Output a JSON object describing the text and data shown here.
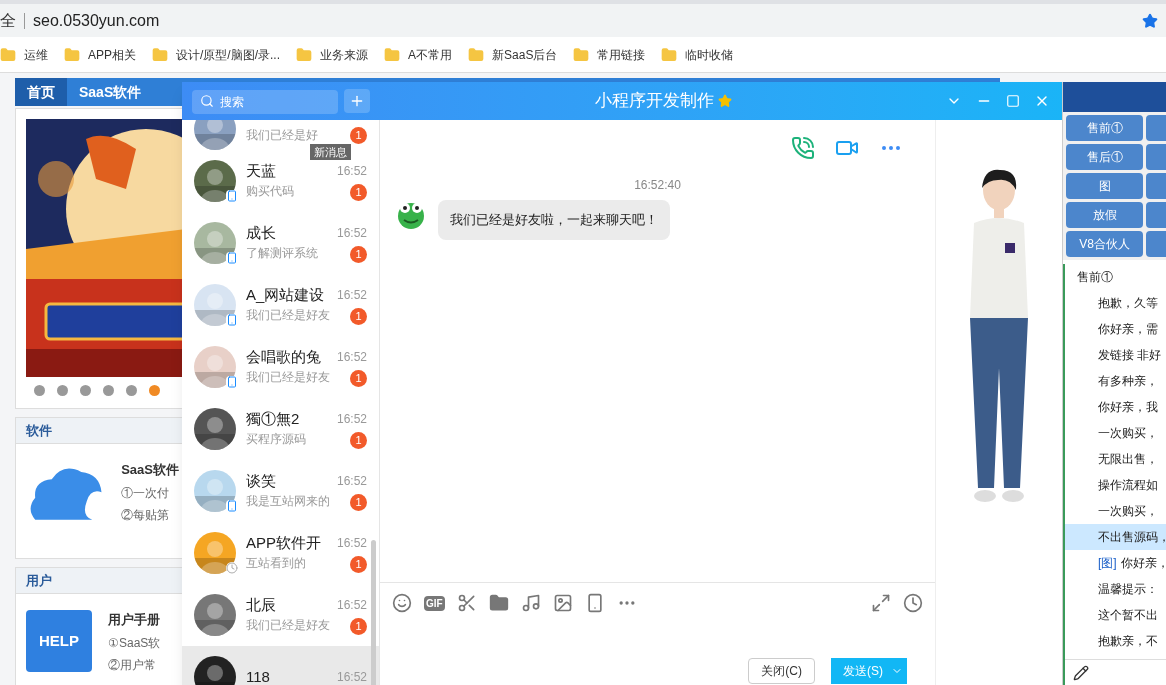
{
  "browser": {
    "address_prefix": "全",
    "url": "seo.0530yun.com",
    "bookmarks": [
      "运维",
      "APP相关",
      "设计/原型/脑图/录...",
      "业务来源",
      "A不常用",
      "新SaaS后台",
      "常用链接",
      "临时收储"
    ]
  },
  "site": {
    "nav": [
      {
        "label": "首页",
        "selected": true
      },
      {
        "label": "SaaS软件",
        "selected": false
      }
    ],
    "banner": {
      "dots": [
        {
          "selected": false
        },
        {
          "selected": false
        },
        {
          "selected": false
        },
        {
          "selected": false
        },
        {
          "selected": false
        },
        {
          "selected": true
        }
      ]
    },
    "sections": [
      {
        "kind": "cloud",
        "title": "软件",
        "item_title": "SaaS软件",
        "lines": [
          "①一次付",
          "②每贴第"
        ]
      },
      {
        "kind": "book",
        "title": "用户",
        "item_title": "用户手册",
        "lines": [
          "①SaaS软",
          "②用户常"
        ],
        "icon_text": "HELP"
      }
    ]
  },
  "chat": {
    "title": "小程序开发制作",
    "search": {
      "placeholder": "搜索"
    },
    "tooltip": "新消息",
    "contacts": [
      {
        "preview": "我们已经是好",
        "badge": "1",
        "selected": false,
        "partial": true,
        "mobile": false,
        "away": false
      },
      {
        "name": "天蓝",
        "preview": "购买代码",
        "time": "16:52",
        "badge": "1",
        "selected": false,
        "partial": false,
        "mobile": true,
        "away": false
      },
      {
        "name": "成长",
        "preview": "了解测评系统",
        "time": "16:52",
        "badge": "1",
        "selected": false,
        "partial": false,
        "mobile": true,
        "away": false
      },
      {
        "name": "A_网站建设",
        "preview": "我们已经是好友",
        "time": "16:52",
        "badge": "1",
        "selected": false,
        "partial": false,
        "mobile": true,
        "away": false
      },
      {
        "name": "会唱歌的兔",
        "preview": "我们已经是好友",
        "time": "16:52",
        "badge": "1",
        "selected": false,
        "partial": false,
        "mobile": true,
        "away": false
      },
      {
        "name": "獨①無2",
        "preview": "买程序源码",
        "time": "16:52",
        "badge": "1",
        "selected": false,
        "partial": false,
        "mobile": false,
        "away": false
      },
      {
        "name": "谈笑",
        "preview": "我是互站网来的",
        "time": "16:52",
        "badge": "1",
        "selected": false,
        "partial": false,
        "mobile": true,
        "away": false
      },
      {
        "name": "APP软件开",
        "preview": "互站看到的",
        "time": "16:52",
        "badge": "1",
        "selected": false,
        "partial": false,
        "mobile": false,
        "away": true
      },
      {
        "name": "北辰",
        "preview": "我们已经是好友",
        "time": "16:52",
        "badge": "1",
        "selected": false,
        "partial": false,
        "mobile": false,
        "away": false
      },
      {
        "name": "118",
        "time": "16:52",
        "selected": true,
        "partial": false,
        "mobile": false,
        "away": false
      }
    ],
    "message": {
      "time": "16:52:40",
      "text": "我们已经是好友啦，一起来聊天吧！"
    },
    "gif_label": "GIF",
    "close_button": "关闭(C)",
    "send_button": "发送(S)"
  },
  "replies": {
    "buttons": [
      "售前①",
      "售后①",
      "图",
      "放假",
      "V8合伙人"
    ],
    "group": "售前①",
    "items": [
      {
        "text": "抱歉，久等",
        "selected": false
      },
      {
        "text": "你好亲，需",
        "selected": false
      },
      {
        "text": "发链接 非好",
        "selected": false
      },
      {
        "text": "有多种亲，",
        "selected": false
      },
      {
        "text": "你好亲，我",
        "selected": false
      },
      {
        "text": "一次购买，",
        "selected": false
      },
      {
        "text": "无限出售，",
        "selected": false
      },
      {
        "text": "操作流程如",
        "selected": false
      },
      {
        "text": "一次购买，",
        "selected": false
      },
      {
        "text": "不出售源码，",
        "selected": true
      },
      {
        "tag": "[图]",
        "text": "你好亲，",
        "selected": false
      },
      {
        "text": "温馨提示：",
        "selected": false
      },
      {
        "text": "这个暂不出",
        "selected": false
      },
      {
        "text": "抱歉亲，不",
        "selected": false
      }
    ]
  }
}
